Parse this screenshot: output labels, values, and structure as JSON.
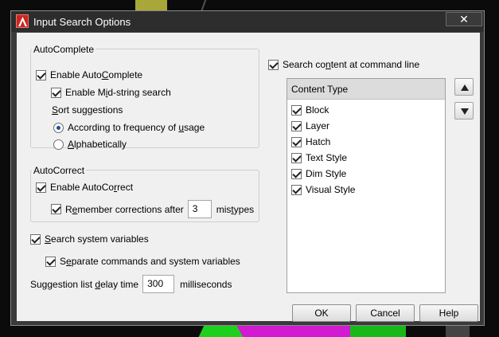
{
  "window": {
    "title": "Input Search Options",
    "close_glyph": "✕"
  },
  "autocomplete": {
    "group_label": "AutoComplete",
    "enable": {
      "pre": "Enable Auto",
      "u": "C",
      "post": "omplete",
      "checked": true
    },
    "midstring": {
      "pre": "Enable M",
      "u": "i",
      "post": "d-string search",
      "checked": true
    },
    "sort_label": {
      "pre": "",
      "u": "S",
      "post": "ort suggestions"
    },
    "sort_options": [
      {
        "pre": "According to frequency of ",
        "u": "u",
        "post": "sage",
        "selected": true
      },
      {
        "pre": "",
        "u": "A",
        "post": "lphabetically",
        "selected": false
      }
    ]
  },
  "autocorrect": {
    "group_label": "AutoCorrect",
    "enable": {
      "pre": "Enable AutoCo",
      "u": "r",
      "post": "rect",
      "checked": true
    },
    "remember": {
      "pre": "R",
      "u": "e",
      "post": "member corrections after",
      "checked": true
    },
    "mistypes_value": "3",
    "mistypes_suffix": {
      "pre": "mis",
      "u": "t",
      "post": "ypes"
    }
  },
  "sysvars": {
    "search": {
      "pre": "",
      "u": "S",
      "post": "earch system variables",
      "checked": true
    },
    "separate": {
      "pre": "S",
      "u": "e",
      "post": "parate commands and system variables",
      "checked": true
    }
  },
  "delay": {
    "label": {
      "pre": "Suggestion list ",
      "u": "d",
      "post": "elay time"
    },
    "value": "300",
    "unit": "milliseconds"
  },
  "content": {
    "search_content": {
      "pre": "Search co",
      "u": "n",
      "post": "tent at command line",
      "checked": true
    },
    "header": "Content Type",
    "items": [
      {
        "label": "Block",
        "checked": true
      },
      {
        "label": "Layer",
        "checked": true
      },
      {
        "label": "Hatch",
        "checked": true
      },
      {
        "label": "Text Style",
        "checked": true
      },
      {
        "label": "Dim Style",
        "checked": true
      },
      {
        "label": "Visual Style",
        "checked": true
      }
    ]
  },
  "buttons": {
    "ok": "OK",
    "cancel": "Cancel",
    "help": "Help"
  },
  "colors": {
    "title_bg": "#2d2d2d",
    "client_bg": "#f0f0f0",
    "radio_dot": "#1a4f9a"
  }
}
